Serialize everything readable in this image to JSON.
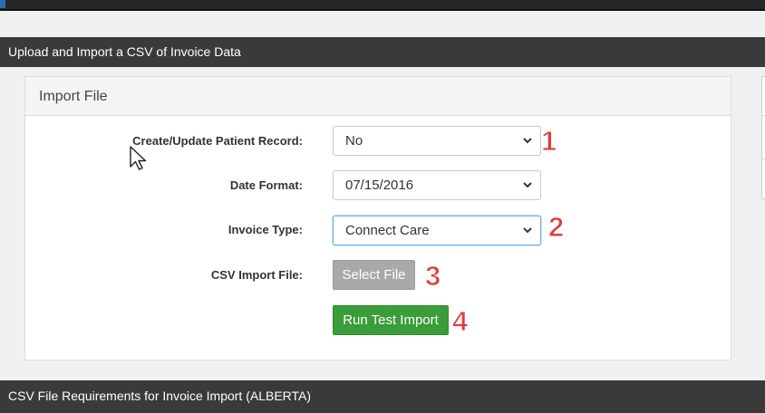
{
  "colors": {
    "header_bar": "#3a3a3a",
    "primary_button": "#3a9d39",
    "disabled_button": "#a9a9a9",
    "annotation": "#e33b3b",
    "focus_border": "#66afe9"
  },
  "sections": {
    "upload_title": "Upload and Import a CSV of Invoice Data",
    "requirements_title": "CSV File Requirements for Invoice Import (ALBERTA)"
  },
  "panel": {
    "title": "Import File"
  },
  "form": {
    "patient_record": {
      "label": "Create/Update Patient Record:",
      "value": "No"
    },
    "date_format": {
      "label": "Date Format:",
      "value": "07/15/2016"
    },
    "invoice_type": {
      "label": "Invoice Type:",
      "value": "Connect Care"
    },
    "csv_file": {
      "label": "CSV Import File:",
      "button": "Select File"
    },
    "run_button": "Run Test Import"
  },
  "annotations": [
    "1",
    "2",
    "3",
    "4"
  ],
  "icons": [
    "chevron-down-icon",
    "mouse-pointer-icon"
  ]
}
